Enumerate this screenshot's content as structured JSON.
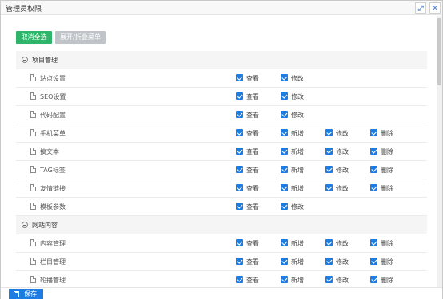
{
  "window": {
    "title": "管理员权限",
    "maximize_icon": "expand-arrows-icon",
    "close_icon": "close-x-icon"
  },
  "toolbar": {
    "deselect_all_label": "取消全选",
    "expand_collapse_label": "展开/折叠菜单"
  },
  "tree": {
    "groups": [
      {
        "label": "项目管理",
        "items": [
          {
            "label": "站点设置",
            "perms": [
              "查看",
              "修改"
            ]
          },
          {
            "label": "SEO设置",
            "perms": [
              "查看",
              "修改"
            ]
          },
          {
            "label": "代码配置",
            "perms": [
              "查看",
              "修改"
            ]
          },
          {
            "label": "手机菜单",
            "perms": [
              "查看",
              "新增",
              "修改",
              "删除"
            ]
          },
          {
            "label": "搞文本",
            "perms": [
              "查看",
              "新增",
              "修改",
              "删除"
            ]
          },
          {
            "label": "TAG标签",
            "perms": [
              "查看",
              "新增",
              "修改",
              "删除"
            ]
          },
          {
            "label": "友情链接",
            "perms": [
              "查看",
              "新增",
              "修改",
              "删除"
            ]
          },
          {
            "label": "模板参数",
            "perms": [
              "查看",
              "修改"
            ]
          }
        ]
      },
      {
        "label": "网站内容",
        "items": [
          {
            "label": "内容管理",
            "perms": [
              "查看",
              "新增",
              "修改",
              "删除"
            ]
          },
          {
            "label": "栏目管理",
            "perms": [
              "查看",
              "新增",
              "修改",
              "删除"
            ]
          },
          {
            "label": "轮播管理",
            "perms": [
              "查看",
              "新增",
              "修改",
              "删除"
            ]
          }
        ]
      }
    ]
  },
  "footer": {
    "save_label": "保存"
  },
  "colors": {
    "primary": "#1e7ce0",
    "success": "#2fb56a",
    "disabled": "#c0c4c8"
  }
}
